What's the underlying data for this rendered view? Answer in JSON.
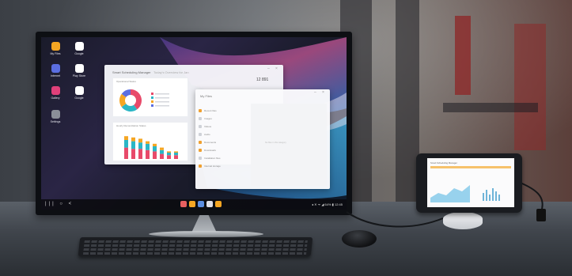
{
  "desktop": {
    "icons": [
      {
        "label": "My Files",
        "icon": "folder-icon",
        "color": "#f5a623"
      },
      {
        "label": "Google",
        "icon": "google-icon",
        "color": "#ffffff"
      },
      {
        "label": "Internet",
        "icon": "globe-icon",
        "color": "#5b6ee1"
      },
      {
        "label": "Play Store",
        "icon": "play-store-icon",
        "color": "#ffffff"
      },
      {
        "label": "Gallery",
        "icon": "gallery-icon",
        "color": "#e0407a"
      },
      {
        "label": "Google",
        "icon": "google-icon",
        "color": "#ffffff"
      },
      {
        "label": "Settings",
        "icon": "gear-icon",
        "color": "#8a8f98"
      }
    ]
  },
  "scheduling_window": {
    "title": "Smart Scheduling Manager",
    "subtitle": "Today's Overview for Jan",
    "stat": "12 891",
    "card1_title": "Operational Status",
    "card2_title": "Hourly Reconciliation Status"
  },
  "files_window": {
    "title": "My Files",
    "items": [
      "Recent files",
      "Images",
      "Videos",
      "Audio",
      "Documents",
      "Downloads",
      "Installation files",
      "Internal storage"
    ],
    "empty_text": "No files in this category"
  },
  "taskbar": {
    "nav": "||| ○ <",
    "status": "◂ ✕ ᯤ ◢ 64% ▮ 12:45",
    "apps": [
      "#e66060",
      "#f5a623",
      "#5b8ee1",
      "#e0e0e8",
      "#f5a623"
    ]
  },
  "tablet": {
    "title": "Smart Scheduling Manager"
  },
  "chart_data": [
    {
      "type": "pie",
      "categories": [
        "A",
        "B",
        "C",
        "D"
      ],
      "values": [
        40,
        25,
        20,
        15
      ]
    },
    {
      "type": "bar",
      "categories": [
        "1",
        "2",
        "3",
        "4",
        "5",
        "6",
        "7",
        "8"
      ],
      "series": [
        {
          "values": [
            9,
            8,
            8,
            7,
            6,
            4,
            3,
            3
          ]
        },
        {
          "values": [
            6,
            6,
            5,
            5,
            4,
            3,
            2,
            2
          ]
        },
        {
          "values": [
            3,
            3,
            3,
            2,
            2,
            2,
            1,
            1
          ]
        }
      ]
    }
  ]
}
